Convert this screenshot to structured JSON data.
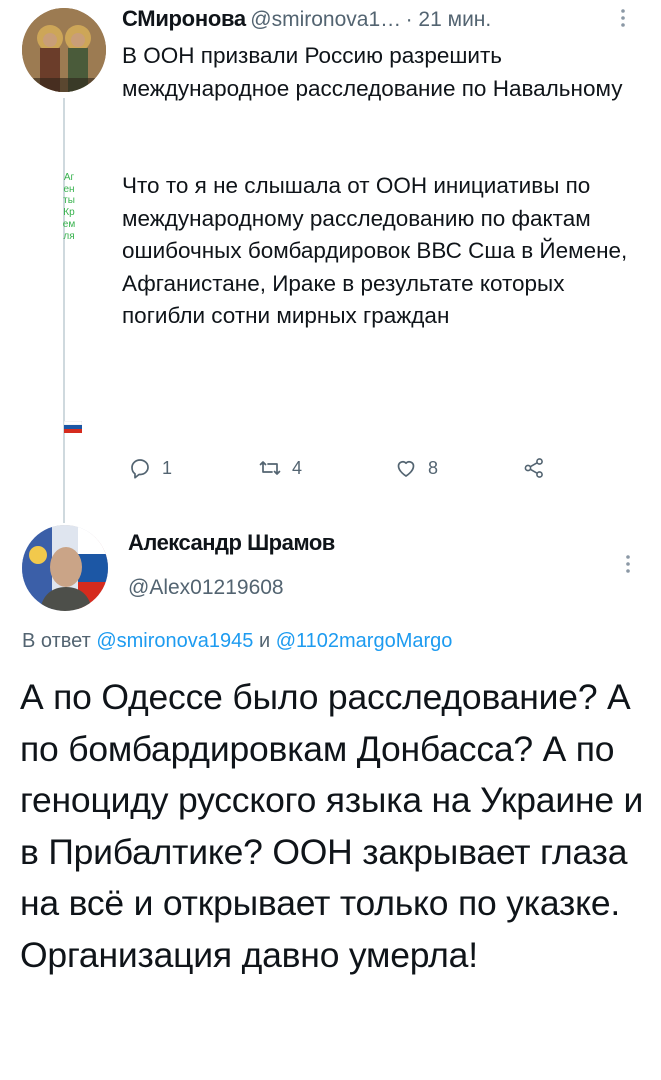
{
  "tweet1": {
    "author_name": "СМиронова",
    "handle": "@smironova1…",
    "time": "· 21 мин.",
    "text_para1": "В ООН призвали Россию разрешить международное расследование по Навальному",
    "text_para2": "Что то я не слышала от ООН инициативы по международному расследованию по фактам ошибочных бомбардировок ВВС Сша в Йемене, Афганистане, Ираке в результате которых погибли сотни мирных граждан",
    "side_caption": "АгентыКремля",
    "actions": {
      "replies": "1",
      "retweets": "4",
      "likes": "8"
    }
  },
  "tweet2": {
    "author_name": "Александр Шрамов",
    "handle": "@Alex01219608",
    "reply_prefix": "В ответ ",
    "reply_user1": "@smironova1945",
    "reply_and": " и ",
    "reply_user2": "@1102margoMargo",
    "text": "А по Одессе было расследование? А по бомбардировкам Донбасса? А по геноциду русского языка на Украине и в Прибалтике? ООН закрывает глаза на всё и открывает только по указке. Организация давно умерла!"
  },
  "icons": {
    "reply": "reply-icon",
    "retweet": "retweet-icon",
    "like": "like-icon",
    "share": "share-icon",
    "more": "more-icon"
  },
  "colors": {
    "link": "#1d9bf0",
    "secondary_text": "#536471",
    "side_caption": "#37b24d",
    "thread_line": "#cfd9de"
  }
}
